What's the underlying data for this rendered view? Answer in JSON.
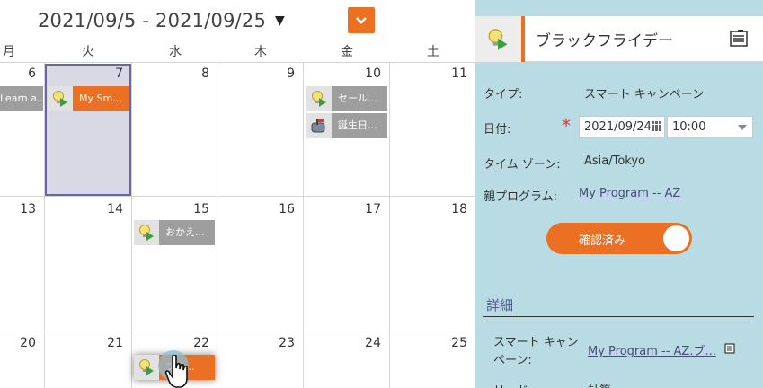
{
  "calendar": {
    "date_range": "2021/09/5 - 2021/09/25",
    "weekdays": [
      "月",
      "火",
      "水",
      "木",
      "金",
      "土"
    ],
    "weeks": [
      [
        "6",
        "7",
        "8",
        "9",
        "10",
        "11"
      ],
      [
        "13",
        "14",
        "15",
        "16",
        "17",
        "18"
      ],
      [
        "20",
        "21",
        "22",
        "23",
        "24",
        "25"
      ]
    ],
    "events": {
      "mon6": "Learn a...",
      "tue7": "My Sm...",
      "fri10_a": "セール...",
      "fri10_b": "誕生日...",
      "wed15": "おかえ...",
      "wed22": "ブラ..."
    }
  },
  "panel": {
    "title": "ブラックフライデー",
    "type_label": "タイプ:",
    "type_value": "スマート キャンペーン",
    "date_label": "日付:",
    "date_value": "2021/09/24",
    "time_value": "10:00",
    "timezone_label": "タイム ゾーン:",
    "timezone_value": "Asia/Tokyo",
    "parent_label": "親プログラム:",
    "parent_value": "My Program -- AZ",
    "status_toggle": "確認済み",
    "details_title": "詳細",
    "smart_campaign_label_1": "スマート キャン",
    "smart_campaign_label_2": "ペーン:",
    "smart_campaign_value": "My Program -- AZ.ブ...",
    "lead_label": "リード:",
    "lead_value": "計算..."
  },
  "colors": {
    "accent": "#eb7024",
    "panel_bg": "#b9dce4",
    "today_border": "#6b65a4",
    "event_gray": "#9e9e9e"
  },
  "icons": {
    "smart_campaign": "smart-campaign-icon",
    "email": "email-program-icon",
    "document": "document-icon"
  }
}
